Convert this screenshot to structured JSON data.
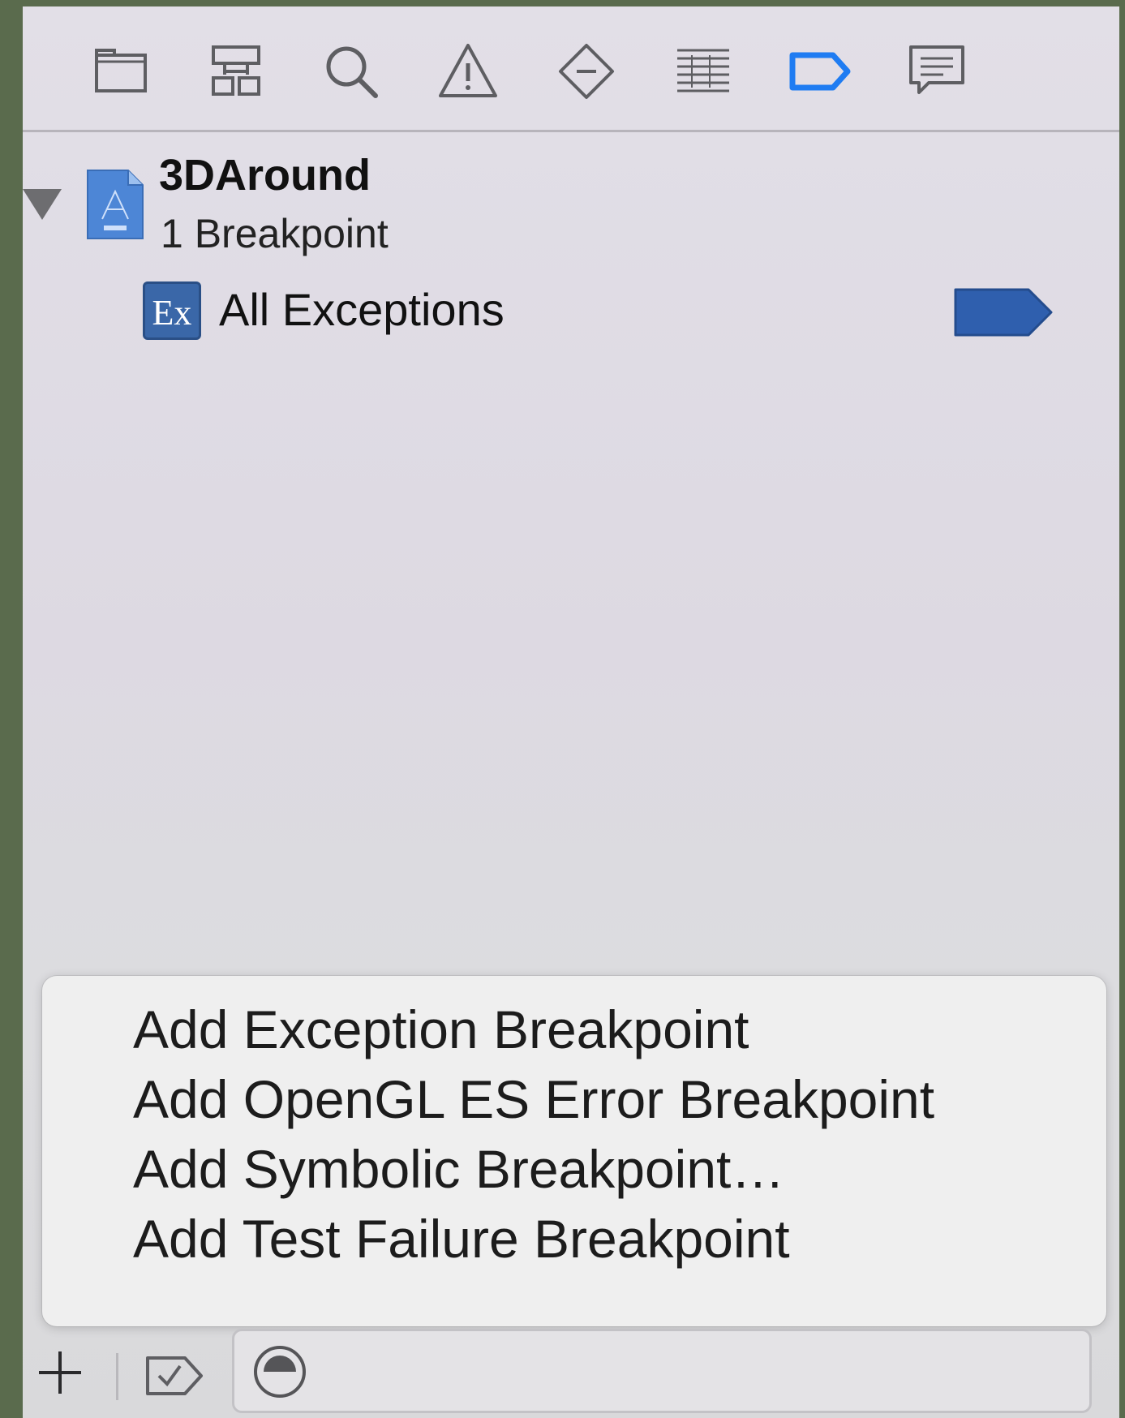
{
  "toolbar": {
    "icons": [
      {
        "name": "project-navigator-icon"
      },
      {
        "name": "symbol-navigator-icon"
      },
      {
        "name": "find-navigator-icon"
      },
      {
        "name": "issue-navigator-icon"
      },
      {
        "name": "test-navigator-icon"
      },
      {
        "name": "debug-navigator-icon"
      },
      {
        "name": "breakpoint-navigator-icon",
        "active": true
      },
      {
        "name": "report-navigator-icon"
      }
    ],
    "active_color": "#1f7cf2",
    "icon_color": "#5e5e62"
  },
  "project": {
    "name": "3DAround",
    "count_label": "1 Breakpoint",
    "breakpoints": [
      {
        "badge": "Ex",
        "label": "All Exceptions",
        "flag_color": "#2f5fae"
      }
    ]
  },
  "menu": {
    "items": [
      "Add Exception Breakpoint",
      "Add OpenGL ES Error Breakpoint",
      "Add Symbolic Breakpoint…",
      "Add Test Failure Breakpoint"
    ]
  },
  "bottom_bar": {
    "add_symbol": "+",
    "filter_placeholder": ""
  }
}
